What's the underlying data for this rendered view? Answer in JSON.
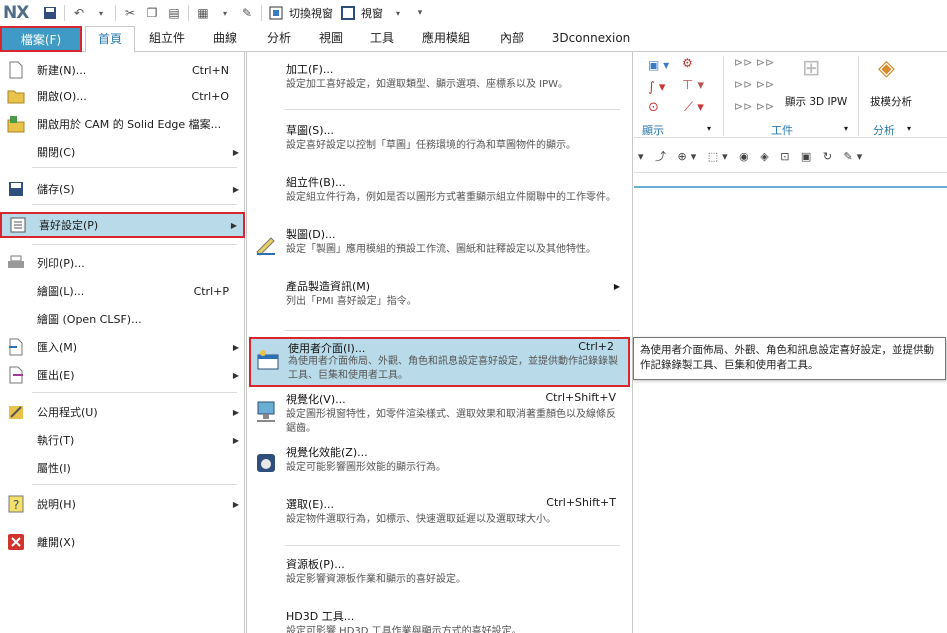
{
  "qat": {
    "logo": "NX",
    "switch_window": "切換視窗",
    "window": "視窗"
  },
  "tabs": [
    "檔案(F)",
    "首頁",
    "組立件",
    "曲線",
    "分析",
    "視圖",
    "工具",
    "應用模組",
    "內部",
    "3Dconnexion"
  ],
  "ribbon": {
    "show_3d_ipw": "顯示 3D IPW",
    "draft_analysis": "拔模分析",
    "grp_display": "顯示",
    "grp_work": "工件",
    "grp_analysis": "分析"
  },
  "left_menu": [
    {
      "label": "新建(N)...",
      "shortcut": "Ctrl+N",
      "arrow": ""
    },
    {
      "label": "開啟(O)...",
      "shortcut": "Ctrl+O",
      "arrow": ""
    },
    {
      "label": "開啟用於 CAM 的 Solid Edge 檔案...",
      "shortcut": "",
      "arrow": ""
    },
    {
      "label": "關閉(C)",
      "shortcut": "",
      "arrow": "▶"
    },
    {
      "label": "儲存(S)",
      "shortcut": "",
      "arrow": "▶"
    },
    {
      "label": "喜好設定(P)",
      "shortcut": "",
      "arrow": "▶"
    },
    {
      "label": "列印(P)...",
      "shortcut": "",
      "arrow": ""
    },
    {
      "label": "繪圖(L)...",
      "shortcut": "Ctrl+P",
      "arrow": ""
    },
    {
      "label": "繪圖 (Open CLSF)...",
      "shortcut": "",
      "arrow": ""
    },
    {
      "label": "匯入(M)",
      "shortcut": "",
      "arrow": "▶"
    },
    {
      "label": "匯出(E)",
      "shortcut": "",
      "arrow": "▶"
    },
    {
      "label": "公用程式(U)",
      "shortcut": "",
      "arrow": "▶"
    },
    {
      "label": "執行(T)",
      "shortcut": "",
      "arrow": "▶"
    },
    {
      "label": "屬性(I)",
      "shortcut": "",
      "arrow": ""
    },
    {
      "label": "說明(H)",
      "shortcut": "",
      "arrow": "▶"
    },
    {
      "label": "離開(X)",
      "shortcut": "",
      "arrow": ""
    }
  ],
  "submenu": [
    {
      "title": "加工(F)...",
      "shortcut": "",
      "desc": "設定加工喜好設定，如選取類型、顯示選項、座標系以及 IPW。"
    },
    {
      "title": "草圖(S)...",
      "shortcut": "",
      "desc": "設定喜好設定以控制「草圖」任務環境的行為和草圖物件的顯示。"
    },
    {
      "title": "組立件(B)...",
      "shortcut": "",
      "desc": "設定組立件行為，例如是否以圖形方式著重顯示組立件關聯中的工作零件。"
    },
    {
      "title": "製圖(D)...",
      "shortcut": "",
      "desc": "設定「製圖」應用模組的預設工作流、圖紙和註釋設定以及其他特性。"
    },
    {
      "title": "產品製造資訊(M)",
      "shortcut": "",
      "desc": "列出「PMI 喜好設定」指令。"
    },
    {
      "title": "使用者介面(I)...",
      "shortcut": "Ctrl+2",
      "desc": "為使用者介面佈局、外觀、角色和訊息設定喜好設定，並提供動作記錄錄製工具、巨集和使用者工具。"
    },
    {
      "title": "視覺化(V)...",
      "shortcut": "Ctrl+Shift+V",
      "desc": "設定圖形視窗特性，如零件渲染樣式、選取效果和取消著重顏色以及線條反鋸齒。"
    },
    {
      "title": "視覺化效能(Z)...",
      "shortcut": "",
      "desc": "設定可能影響圖形效能的顯示行為。"
    },
    {
      "title": "選取(E)...",
      "shortcut": "Ctrl+Shift+T",
      "desc": "設定物件選取行為，如標示、快速選取延遲以及選取球大小。"
    },
    {
      "title": "資源板(P)...",
      "shortcut": "",
      "desc": "設定影響資源板作業和顯示的喜好設定。"
    },
    {
      "title": "HD3D 工具...",
      "shortcut": "",
      "desc": "設定可影響 HD3D 工具作業與顯示方式的喜好設定。"
    }
  ],
  "tooltip": "為使用者介面佈局、外觀、角色和訊息設定喜好設定，並提供動作記錄錄製工具、巨集和使用者工具。",
  "colors": {
    "file_tab": "#3f9bc6",
    "highlight": "#b9dbe9",
    "red_outline": "#d9262e",
    "accent_text": "#2a7ab0"
  }
}
